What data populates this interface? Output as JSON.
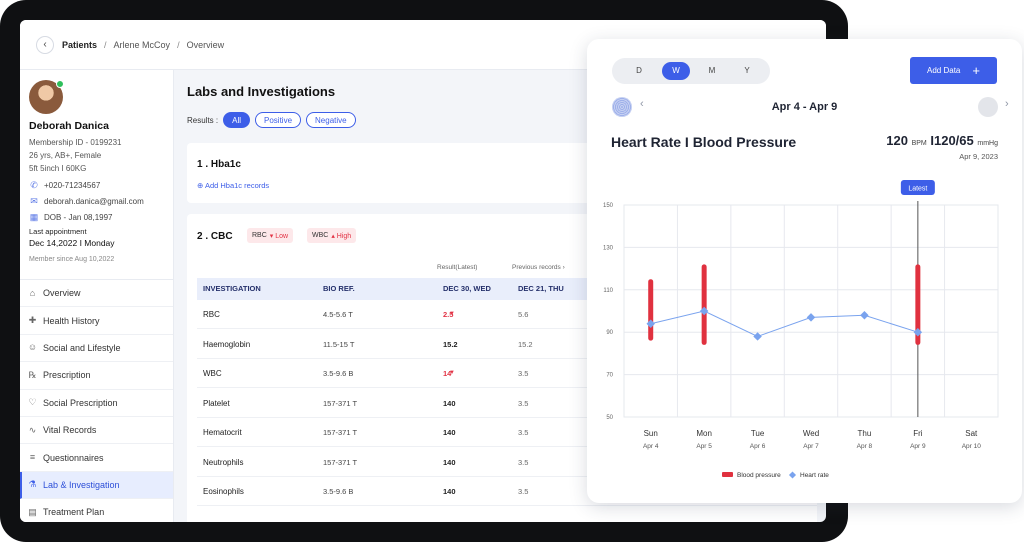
{
  "breadcrumb": {
    "back": "‹",
    "patients": "Patients",
    "sep": "/",
    "patient": "Arlene McCoy",
    "page": "Overview"
  },
  "profile": {
    "name": "Deborah Danica",
    "membership": "Membership ID - 0199231",
    "demographics": "26 yrs, AB+, Female",
    "body": "5ft 5inch  I  60KG",
    "phone": "+020-71234567",
    "email": "deborah.danica@gmail.com",
    "dob": "DOB - Jan 08,1997",
    "last_appt_label": "Last appointment",
    "last_appt": "Dec 14,2022 I Monday",
    "member_since": "Member since Aug 10,2022"
  },
  "menu": [
    {
      "label": "Overview",
      "icon": "overview-icon",
      "glyph": "⌂",
      "active": false
    },
    {
      "label": "Health History",
      "icon": "health-history-icon",
      "glyph": "✚",
      "active": false
    },
    {
      "label": "Social and Lifestyle",
      "icon": "social-icon",
      "glyph": "☺",
      "active": false
    },
    {
      "label": "Prescription",
      "icon": "prescription-icon",
      "glyph": "℞",
      "active": false
    },
    {
      "label": "Social Prescription",
      "icon": "heart-icon",
      "glyph": "♡",
      "active": false
    },
    {
      "label": "Vital Records",
      "icon": "pulse-icon",
      "glyph": "∿",
      "active": false
    },
    {
      "label": "Questionnaires",
      "icon": "list-icon",
      "glyph": "≡",
      "active": false
    },
    {
      "label": "Lab & Investigation",
      "icon": "lab-icon",
      "glyph": "⚗",
      "active": true
    },
    {
      "label": "Treatment Plan",
      "icon": "document-icon",
      "glyph": "▤",
      "active": false
    }
  ],
  "main": {
    "title": "Labs and Investigations",
    "results_label": "Results :",
    "filters": [
      {
        "label": "All",
        "active": true
      },
      {
        "label": "Positive",
        "active": false
      },
      {
        "label": "Negative",
        "active": false
      }
    ],
    "hba1c": {
      "title": "1 . Hba1c",
      "add_link": "⊕ Add Hba1c records"
    },
    "cbc": {
      "title": "2 . CBC",
      "tags": [
        {
          "name": "RBC",
          "level": "▾ Low"
        },
        {
          "name": "WBC",
          "level": "▴ High"
        }
      ],
      "result_latest": "Result(Latest)",
      "previous_records": "Previous records  ›",
      "columns": {
        "investigation": "INVESTIGATION",
        "bio_ref": "BIO REF.",
        "latest": "DEC 30, WED",
        "previous": "DEC 21, THU"
      },
      "rows": [
        {
          "name": "RBC",
          "ref": "4.5-5.6 T",
          "latest": "2.5",
          "prev": "5.6",
          "low": true
        },
        {
          "name": "Haemoglobin",
          "ref": "11.5-15 T",
          "latest": "15.2",
          "prev": "15.2",
          "low": false
        },
        {
          "name": "WBC",
          "ref": "3.5-9.6 B",
          "latest": "14",
          "prev": "3.5",
          "low": true
        },
        {
          "name": "Platelet",
          "ref": "157-371 T",
          "latest": "140",
          "prev": "3.5",
          "low": false
        },
        {
          "name": "Hematocrit",
          "ref": "157-371 T",
          "latest": "140",
          "prev": "3.5",
          "low": false
        },
        {
          "name": "Neutrophils",
          "ref": "157-371 T",
          "latest": "140",
          "prev": "3.5",
          "low": false
        },
        {
          "name": "Eosinophils",
          "ref": "3.5-9.6 B",
          "latest": "140",
          "prev": "3.5",
          "low": false
        }
      ]
    }
  },
  "panel": {
    "periods": [
      {
        "label": "D",
        "on": false
      },
      {
        "label": "W",
        "on": true
      },
      {
        "label": "M",
        "on": false
      },
      {
        "label": "Y",
        "on": false
      }
    ],
    "add_data": "Add Data",
    "add_icon": "+",
    "range": "Apr 4 - Apr 9",
    "title": "Heart Rate I Blood Pressure",
    "bpm_value": "120",
    "bpm_unit": "BPM",
    "bp_sep": "I",
    "bp_value": "120/65",
    "bp_unit": "mmHg",
    "date": "Apr 9, 2023",
    "colors": {
      "accent": "#3d5ee8",
      "blood_pressure": "#e0313f",
      "heart_rate": "#7aa3ee"
    }
  },
  "chart_data": {
    "type": "line",
    "categories": [
      "Sun",
      "Mon",
      "Tue",
      "Wed",
      "Thu",
      "Fri",
      "Sat"
    ],
    "category_dates": [
      "Apr 4",
      "Apr 5",
      "Apr 6",
      "Apr 7",
      "Apr 8",
      "Apr 9",
      "Apr 10"
    ],
    "yticks": [
      150,
      130,
      110,
      90,
      70,
      50
    ],
    "ylim": [
      50,
      150
    ],
    "grid": true,
    "marker_label": "Latest",
    "marker_index": 5,
    "series": [
      {
        "name": "Blood pressure",
        "kind": "range",
        "ranges": [
          [
            86,
            115
          ],
          [
            84,
            122
          ],
          null,
          null,
          null,
          [
            84,
            122
          ],
          null
        ]
      },
      {
        "name": "Heart rate",
        "kind": "line",
        "values": [
          94,
          100,
          88,
          97,
          98,
          90,
          null
        ]
      }
    ],
    "legend_placement": "bottom-center"
  }
}
